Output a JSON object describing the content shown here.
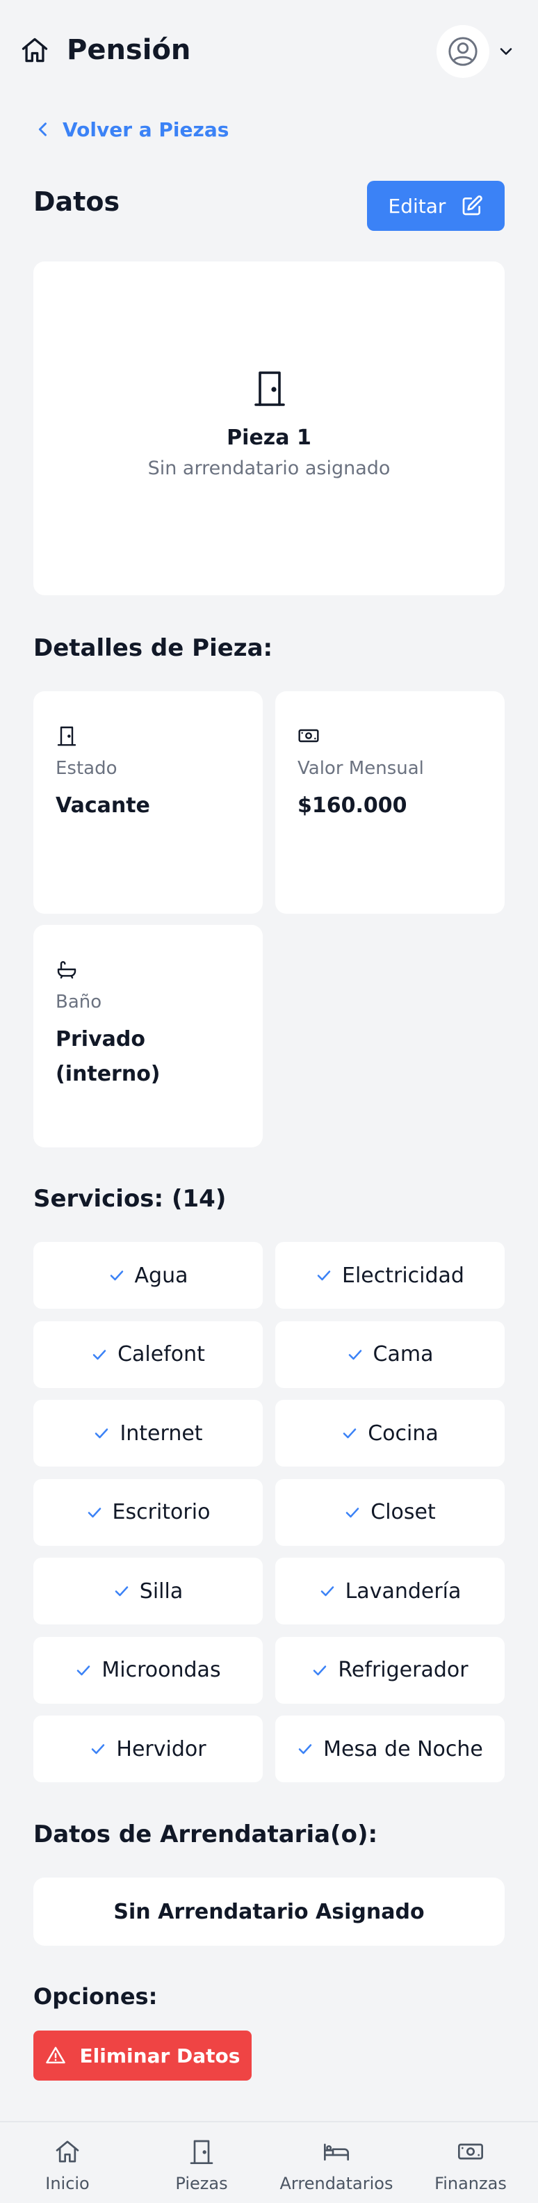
{
  "header": {
    "home_icon": "home-icon",
    "title": "Pensión",
    "avatar_icon": "user-circle-icon",
    "menu_icon": "chevron-down-icon"
  },
  "back_link": {
    "label": "Volver a Piezas",
    "icon": "chevron-left-icon"
  },
  "datos_section": {
    "title": "Datos",
    "edit_button": {
      "label": "Editar",
      "icon": "edit-icon"
    }
  },
  "room": {
    "icon": "door-icon",
    "name": "Pieza 1",
    "subtitle": "Sin arrendatario asignado"
  },
  "details": {
    "title": "Detalles de Pieza:",
    "items": [
      {
        "icon": "door-icon",
        "label": "Estado",
        "value": "Vacante"
      },
      {
        "icon": "money-icon",
        "label": "Valor Mensual",
        "value": "$160.000"
      },
      {
        "icon": "bathtub-icon",
        "label": "Baño",
        "value": "Privado (interno)"
      }
    ]
  },
  "services": {
    "title": "Servicios: (14)",
    "check_icon": "check-icon",
    "items": [
      "Agua",
      "Electricidad",
      "Calefont",
      "Cama",
      "Internet",
      "Cocina",
      "Escritorio",
      "Closet",
      "Silla",
      "Lavandería",
      "Microondas",
      "Refrigerador",
      "Hervidor",
      "Mesa de Noche"
    ]
  },
  "tenant": {
    "title": "Datos de Arrendataria(o):",
    "status": "Sin Arrendatario Asignado"
  },
  "options": {
    "title": "Opciones:",
    "delete_button": {
      "label": "Eliminar Datos",
      "icon": "warning-icon"
    }
  },
  "bottom_nav": [
    {
      "label": "Inicio",
      "icon": "home-icon"
    },
    {
      "label": "Piezas",
      "icon": "door-icon"
    },
    {
      "label": "Arrendatarios",
      "icon": "bed-icon"
    },
    {
      "label": "Finanzas",
      "icon": "money-icon"
    }
  ],
  "colors": {
    "accent": "#3b82f6",
    "danger": "#ef4444",
    "background": "#f3f4f6",
    "card": "#ffffff"
  }
}
